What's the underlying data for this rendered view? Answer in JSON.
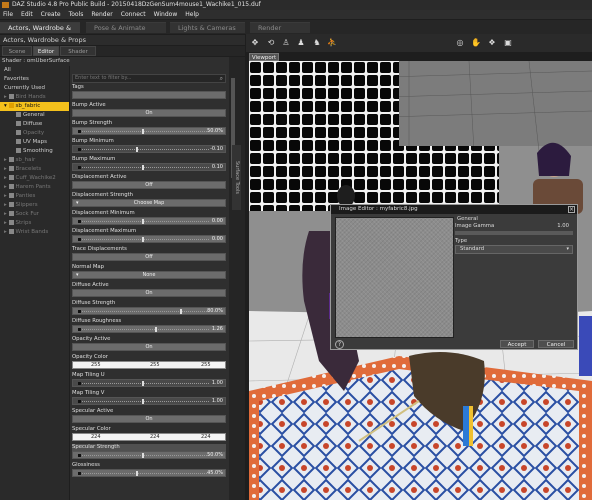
{
  "window": {
    "title": "DAZ Studio 4.8 Pro Public Build - 20150418DzGenSum4mouse1_Wachike1_015.duf"
  },
  "menu": [
    "File",
    "Edit",
    "Create",
    "Tools",
    "Render",
    "Connect",
    "Window",
    "Help"
  ],
  "room_tabs": [
    "Actors, Wardrobe & Props",
    "Pose & Animate",
    "Lights & Cameras",
    "Render"
  ],
  "left_panel": {
    "header": "Actors, Wardrobe & Props",
    "tabs": [
      "Scene",
      "Editor",
      "Shader Baker"
    ],
    "shader_title": "Shader : omUberSurface",
    "filter_placeholder": "Enter text to filter by...",
    "tree": [
      {
        "label": "All",
        "state": "normal"
      },
      {
        "label": "Favorites",
        "state": "normal"
      },
      {
        "label": "Currently Used",
        "state": "normal"
      },
      {
        "label": "Bird Hands",
        "state": "dim"
      },
      {
        "label": "sb_fabric",
        "state": "selected"
      },
      {
        "label": "General",
        "state": "normal"
      },
      {
        "label": "Diffuse",
        "state": "normal"
      },
      {
        "label": "Opacity",
        "state": "dim"
      },
      {
        "label": "UV Maps",
        "state": "normal"
      },
      {
        "label": "Smoothing",
        "state": "normal"
      },
      {
        "label": "sb_hair",
        "state": "dim"
      },
      {
        "label": "Bracelets",
        "state": "dim"
      },
      {
        "label": "Cuff_Wachike2",
        "state": "dim"
      },
      {
        "label": "Harem Pants",
        "state": "dim"
      },
      {
        "label": "Panties",
        "state": "dim"
      },
      {
        "label": "Slippers",
        "state": "dim"
      },
      {
        "label": "Sock Fur",
        "state": "dim"
      },
      {
        "label": "Strips",
        "state": "dim"
      },
      {
        "label": "Wrist Bands",
        "state": "dim"
      }
    ],
    "properties": [
      {
        "label": "Tags",
        "kind": "text",
        "value": ""
      },
      {
        "label": "Bump Active",
        "kind": "button",
        "value": "On"
      },
      {
        "label": "Bump Strength",
        "kind": "slider",
        "value": "50.0%",
        "fill": 0.5
      },
      {
        "label": "Bump Minimum",
        "kind": "slider",
        "value": "-0.10",
        "fill": 0.45,
        "dim": true
      },
      {
        "label": "Bump Maximum",
        "kind": "slider",
        "value": "0.10",
        "fill": 0.5,
        "dim": true
      },
      {
        "label": "Displacement Active",
        "kind": "button",
        "value": "Off"
      },
      {
        "label": "Displacement Strength",
        "kind": "map",
        "value": "Choose Map"
      },
      {
        "label": "Displacement Minimum",
        "kind": "slider",
        "value": "0.00",
        "fill": 0.5
      },
      {
        "label": "Displacement Maximum",
        "kind": "slider",
        "value": "0.00",
        "fill": 0.5
      },
      {
        "label": "Trace Displacements",
        "kind": "button",
        "value": "Off"
      },
      {
        "label": "Normal Map",
        "kind": "map",
        "value": "None"
      },
      {
        "label": "Diffuse Active",
        "kind": "button",
        "value": "On"
      },
      {
        "label": "Diffuse Strength",
        "kind": "slider",
        "value": "80.0%",
        "fill": 0.8
      },
      {
        "label": "Diffuse Roughness",
        "kind": "slider",
        "value": "1.26",
        "fill": 0.6
      },
      {
        "label": "Opacity Active",
        "kind": "button",
        "value": "On"
      },
      {
        "label": "Opacity Color",
        "kind": "color",
        "value": [
          "255",
          "255",
          "255"
        ]
      },
      {
        "label": "Map Tiling U",
        "kind": "slider",
        "value": "1.00",
        "fill": 0.5,
        "dim": true
      },
      {
        "label": "Map Tiling V",
        "kind": "slider",
        "value": "1.00",
        "fill": 0.5,
        "dim": true
      },
      {
        "label": "Specular Active",
        "kind": "button",
        "value": "On"
      },
      {
        "label": "Specular Color",
        "kind": "color",
        "value": [
          "224",
          "224",
          "224"
        ]
      },
      {
        "label": "Specular Strength",
        "kind": "slider",
        "value": "50.0%",
        "fill": 0.5
      },
      {
        "label": "Glossiness",
        "kind": "slider",
        "value": "45.0%",
        "fill": 0.45
      }
    ],
    "vertical_tab": "Surface Tools"
  },
  "viewport": {
    "tab": "Viewport"
  },
  "image_editor": {
    "title": "Image Editor : myfabric8.jpg",
    "general_label": "General",
    "gamma_label": "Image Gamma",
    "gamma_value": "1.00",
    "type_label": "Type",
    "type_value": "Standard",
    "help": "?",
    "accept": "Accept",
    "cancel": "Cancel"
  }
}
